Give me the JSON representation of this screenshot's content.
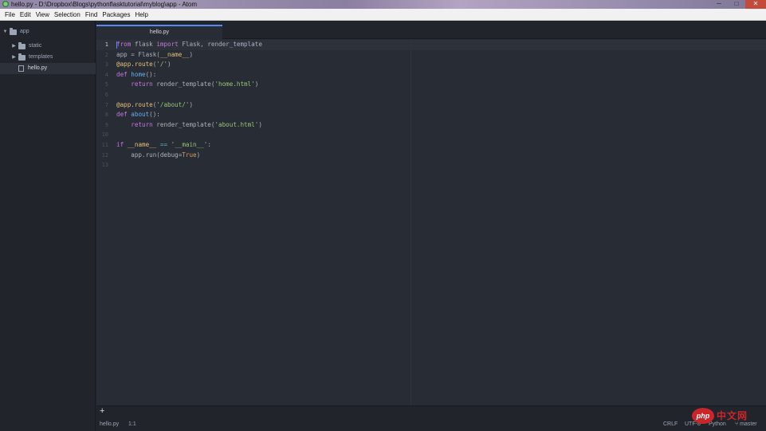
{
  "window": {
    "title": "hello.py - D:\\Dropbox\\Blogs\\pythonflasktutorial\\myblog\\app - Atom",
    "controls": [
      "─",
      "□",
      "✕"
    ]
  },
  "menubar": {
    "items": [
      "File",
      "Edit",
      "View",
      "Selection",
      "Find",
      "Packages",
      "Help"
    ]
  },
  "tree_view": {
    "root": {
      "label": "app",
      "expanded": true
    },
    "items": [
      {
        "label": "static",
        "kind": "folder",
        "expanded": false
      },
      {
        "label": "templates",
        "kind": "folder",
        "expanded": false
      },
      {
        "label": "hello.py",
        "kind": "file",
        "selected": true
      }
    ]
  },
  "tabs": [
    {
      "label": "hello.py",
      "active": true
    }
  ],
  "editor": {
    "line_numbers": [
      "1",
      "2",
      "3",
      "4",
      "5",
      "6",
      "7",
      "8",
      "9",
      "10",
      "11",
      "12",
      "13"
    ],
    "active_line": 1,
    "lines": [
      "from flask import Flask, render_template",
      "app = Flask(__name__)",
      "@app.route('/')",
      "def home():",
      "    return render_template('home.html')",
      "",
      "@app.route('/about/')",
      "def about():",
      "    return render_template('about.html')",
      "",
      "if __name__ == '__main__':",
      "    app.run(debug=True)",
      ""
    ]
  },
  "statusbar": {
    "add_label": "+",
    "file": "hello.py",
    "cursor_position": "1:1",
    "line_ending": "CRLF",
    "encoding": "UTF-8",
    "grammar": "Python",
    "branch": "master"
  },
  "watermark": {
    "badge": "php",
    "text": "中文网"
  },
  "colors": {
    "editor_bg": "#282c34",
    "panel_bg": "#21252b",
    "accent": "#568af2",
    "keyword": "#c678dd",
    "function": "#61afef",
    "string": "#98c379",
    "decorator": "#e5c07b",
    "constant": "#d19a66"
  }
}
